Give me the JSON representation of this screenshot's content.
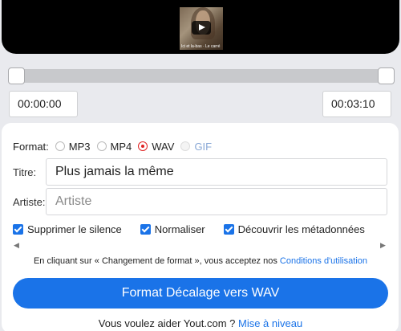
{
  "video": {
    "caption": "Ici et la-bas · Le carré"
  },
  "trim": {
    "start_time": "00:00:00",
    "end_time": "00:03:10"
  },
  "format": {
    "label": "Format:",
    "options": [
      {
        "label": "MP3",
        "selected": false,
        "disabled": false
      },
      {
        "label": "MP4",
        "selected": false,
        "disabled": false
      },
      {
        "label": "WAV",
        "selected": true,
        "disabled": false
      },
      {
        "label": "GIF",
        "selected": false,
        "disabled": true
      }
    ]
  },
  "title_field": {
    "label": "Titre:",
    "value": "Plus jamais la même"
  },
  "artist_field": {
    "label": "Artiste:",
    "placeholder": "Artiste"
  },
  "options": {
    "remove_silence": "Supprimer le silence",
    "normalize": "Normaliser",
    "discover_metadata": "Découvrir les métadonnées"
  },
  "terms": {
    "text": "En cliquant sur « Changement de format », vous acceptez nos",
    "link": "Conditions d'utilisation"
  },
  "convert_button": "Format Décalage vers WAV",
  "footer": {
    "text": "Vous voulez aider Yout.com ?",
    "link": "Mise à niveau"
  },
  "colors": {
    "accent": "#1a73e8",
    "selected_radio": "#e02222"
  }
}
